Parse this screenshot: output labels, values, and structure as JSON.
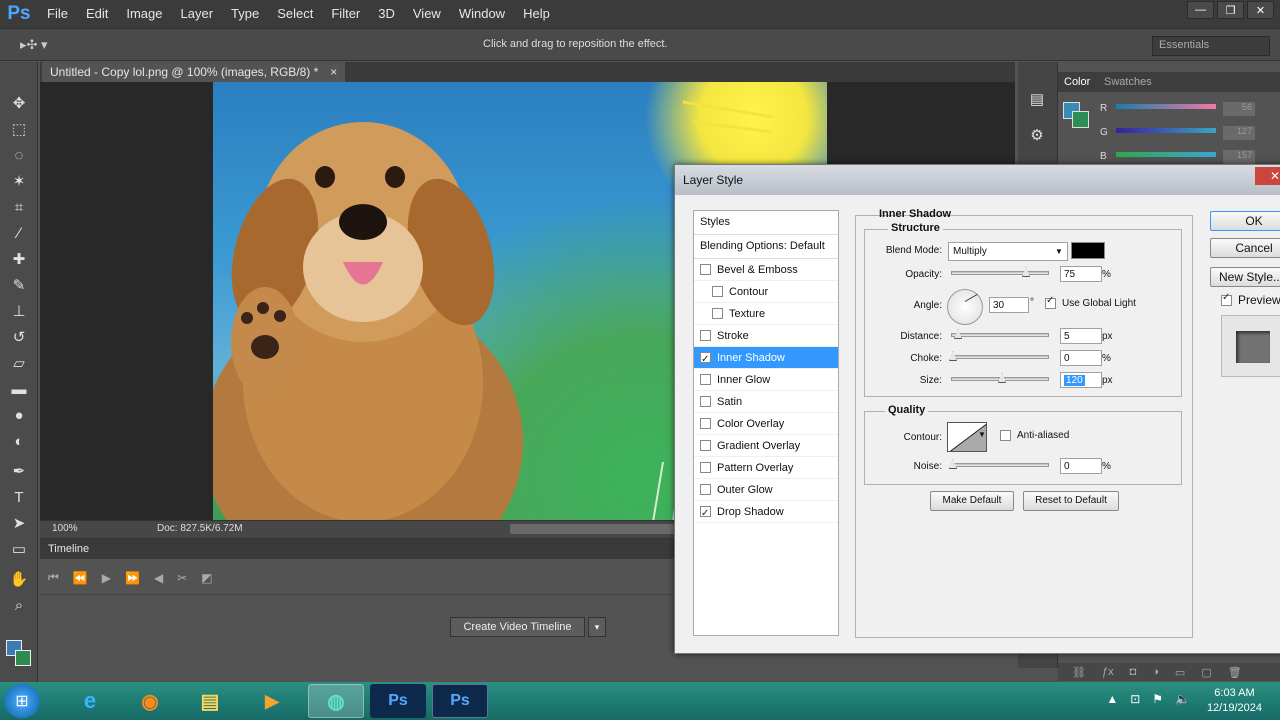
{
  "app": {
    "logo": "Ps"
  },
  "menu": [
    "File",
    "Edit",
    "Image",
    "Layer",
    "Type",
    "Select",
    "Filter",
    "3D",
    "View",
    "Window",
    "Help"
  ],
  "window_controls": {
    "minimize": "—",
    "restore": "❐",
    "close": "✕"
  },
  "options_bar": {
    "tool_icon": "▸✣ ▾",
    "hint": "Click and drag to reposition the effect.",
    "workspace": "Essentials"
  },
  "document": {
    "tab_title": "Untitled - Copy lol.png @ 100% (images, RGB/8) *",
    "tab_close": "×",
    "zoom": "100%",
    "doc_info": "Doc: 827.5K/6.72M"
  },
  "timeline": {
    "title": "Timeline",
    "create_button": "Create Video Timeline",
    "dropdown_arrow": "▾"
  },
  "color_panel": {
    "tabs": [
      "Color",
      "Swatches"
    ],
    "channels": [
      {
        "label": "R",
        "value": "56"
      },
      {
        "label": "G",
        "value": "127"
      },
      {
        "label": "B",
        "value": "157"
      }
    ]
  },
  "dialog": {
    "title": "Layer Style",
    "close": "✕",
    "styles_header": "Styles",
    "blending_options": "Blending Options: Default",
    "effects": [
      {
        "label": "Bevel & Emboss",
        "checked": false,
        "indent": false
      },
      {
        "label": "Contour",
        "checked": false,
        "indent": true
      },
      {
        "label": "Texture",
        "checked": false,
        "indent": true
      },
      {
        "label": "Stroke",
        "checked": false,
        "indent": false
      },
      {
        "label": "Inner Shadow",
        "checked": true,
        "indent": false,
        "selected": true
      },
      {
        "label": "Inner Glow",
        "checked": false,
        "indent": false
      },
      {
        "label": "Satin",
        "checked": false,
        "indent": false
      },
      {
        "label": "Color Overlay",
        "checked": false,
        "indent": false
      },
      {
        "label": "Gradient Overlay",
        "checked": false,
        "indent": false
      },
      {
        "label": "Pattern Overlay",
        "checked": false,
        "indent": false
      },
      {
        "label": "Outer Glow",
        "checked": false,
        "indent": false
      },
      {
        "label": "Drop Shadow",
        "checked": true,
        "indent": false
      }
    ],
    "group_title": "Inner Shadow",
    "structure": {
      "title": "Structure",
      "blend_mode_label": "Blend Mode:",
      "blend_mode": "Multiply",
      "opacity_label": "Opacity:",
      "opacity": "75",
      "opacity_unit": "%",
      "angle_label": "Angle:",
      "angle": "30",
      "angle_unit": "°",
      "global_light_label": "Use Global Light",
      "global_light": true,
      "distance_label": "Distance:",
      "distance": "5",
      "distance_unit": "px",
      "choke_label": "Choke:",
      "choke": "0",
      "choke_unit": "%",
      "size_label": "Size:",
      "size": "120",
      "size_unit": "px"
    },
    "quality": {
      "title": "Quality",
      "contour_label": "Contour:",
      "antialiased_label": "Anti-aliased",
      "noise_label": "Noise:",
      "noise": "0",
      "noise_unit": "%"
    },
    "make_default": "Make Default",
    "reset_default": "Reset to Default",
    "ok": "OK",
    "cancel": "Cancel",
    "new_style": "New Style...",
    "preview_label": "Preview"
  },
  "taskbar": {
    "start_icon": "⊞",
    "clock_time": "6:03 AM",
    "clock_date": "12/19/2024"
  }
}
